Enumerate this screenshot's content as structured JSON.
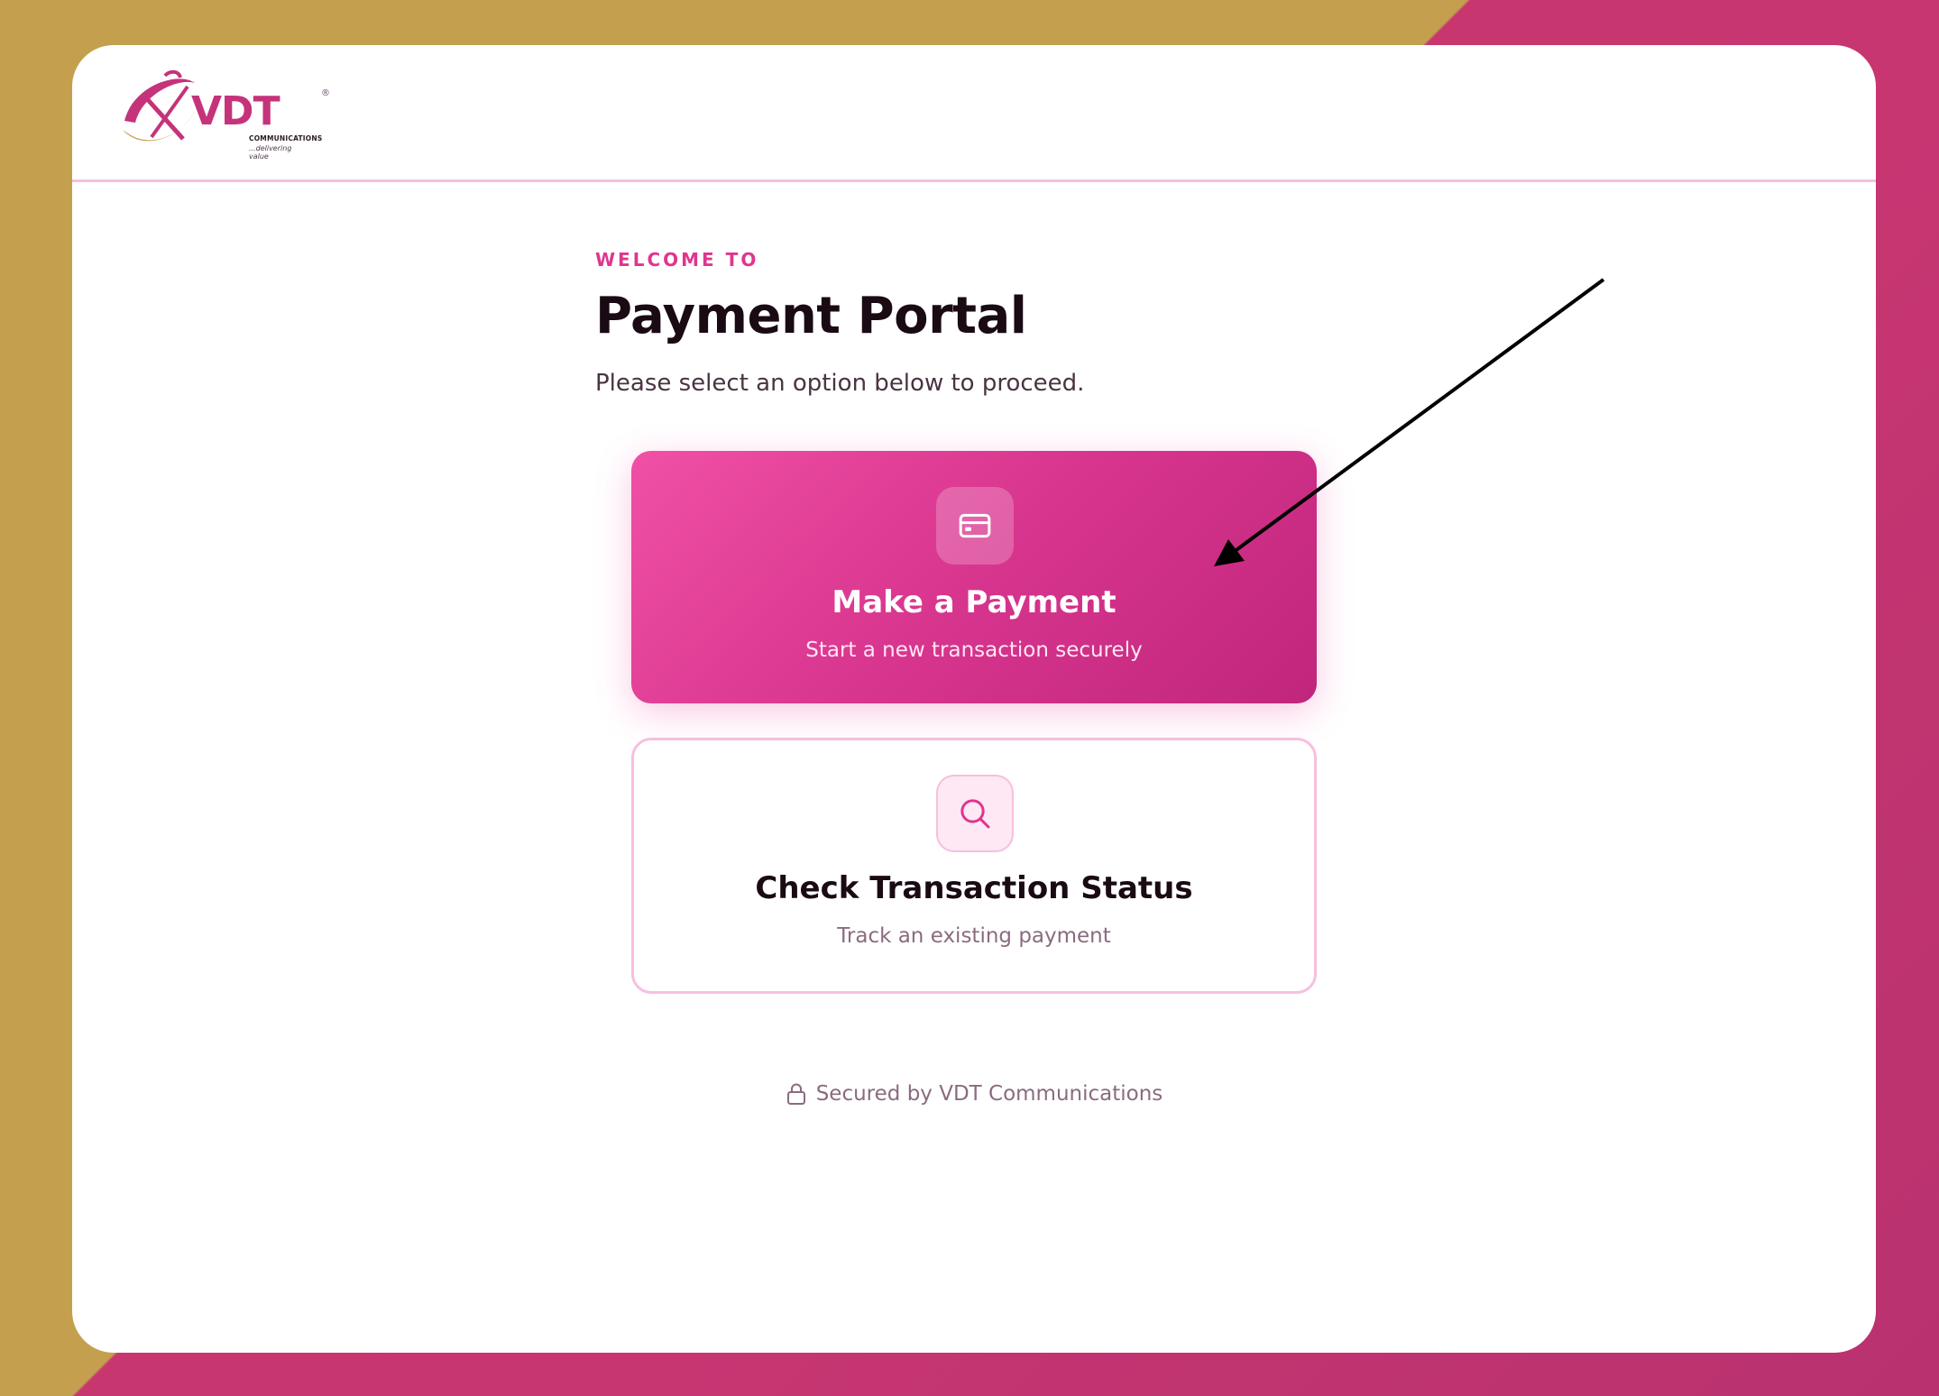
{
  "brand": {
    "name": "VDT",
    "registered": "®",
    "sub": "COMMUNICATIONS",
    "tagline": "...delivering value",
    "colors": {
      "primary": "#e0358f",
      "gold": "#c4a04e",
      "dark": "#1a0a13"
    }
  },
  "hero": {
    "eyebrow": "WELCOME TO",
    "title": "Payment Portal",
    "subtitle": "Please select an option below to proceed."
  },
  "options": [
    {
      "icon": "credit-card-icon",
      "title": "Make a Payment",
      "description": "Start a new transaction securely"
    },
    {
      "icon": "search-icon",
      "title": "Check Transaction Status",
      "description": "Track an existing payment"
    }
  ],
  "footer": {
    "icon": "lock-icon",
    "text": "Secured by VDT Communications"
  }
}
